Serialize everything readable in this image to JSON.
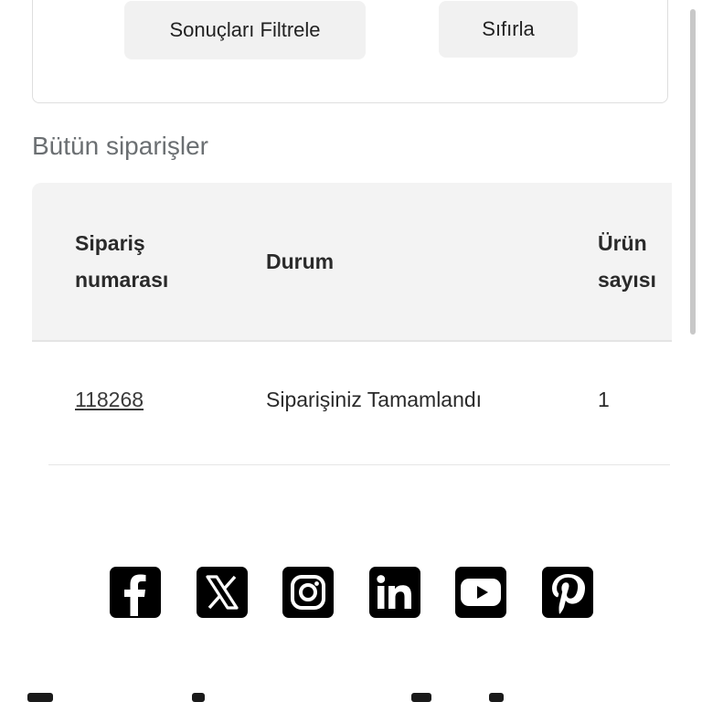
{
  "filter": {
    "filter_button_label": "Sonuçları Filtrele",
    "reset_button_label": "Sıfırla"
  },
  "orders_section": {
    "title": "Bütün siparişler",
    "columns": {
      "order_number": "Sipariş numarası",
      "status": "Durum",
      "item_count": "Ürün sayısı"
    },
    "rows": [
      {
        "order_number": "118268",
        "status": "Siparişiniz Tamamlandı",
        "item_count": "1"
      }
    ]
  },
  "social_links": [
    {
      "icon": "facebook-icon"
    },
    {
      "icon": "x-twitter-icon"
    },
    {
      "icon": "instagram-icon"
    },
    {
      "icon": "linkedin-icon"
    },
    {
      "icon": "youtube-icon"
    },
    {
      "icon": "pinterest-icon"
    }
  ]
}
